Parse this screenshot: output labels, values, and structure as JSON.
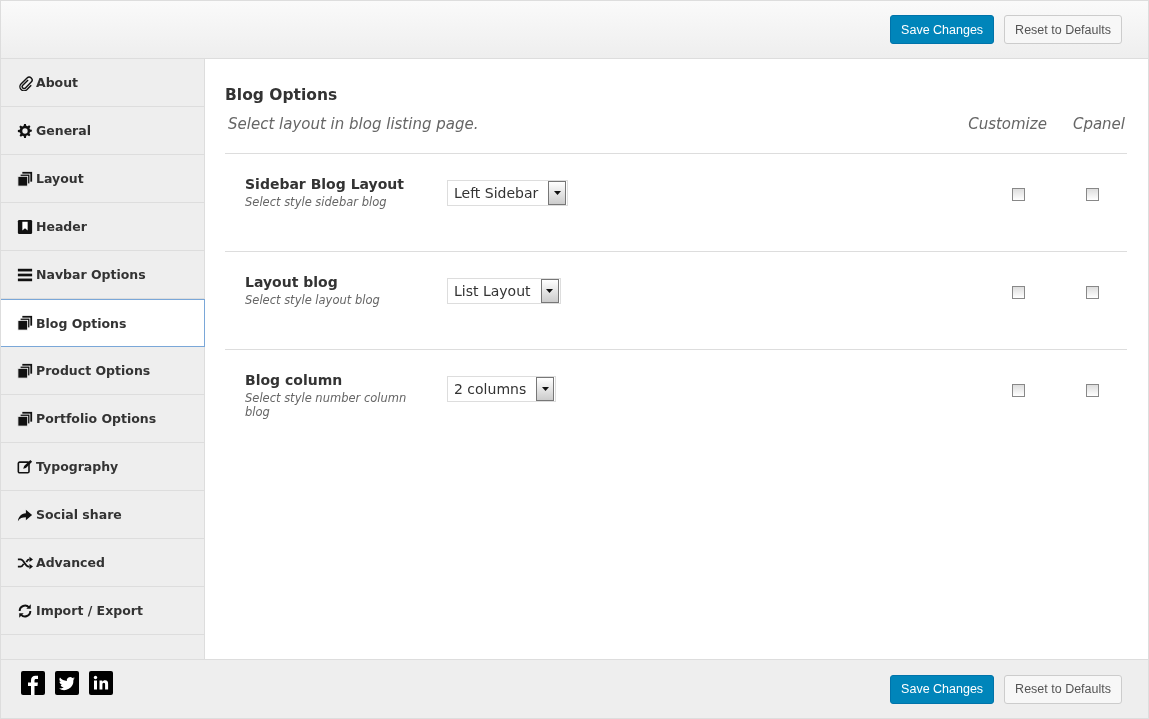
{
  "header": {
    "buttons": [
      {
        "label": "Save Changes",
        "kind": "primary"
      },
      {
        "label": "Reset to Defaults",
        "kind": "secondary"
      }
    ]
  },
  "sidebar": {
    "items": [
      {
        "label": "About",
        "selected": false
      },
      {
        "label": "General",
        "selected": false
      },
      {
        "label": "Layout",
        "selected": false
      },
      {
        "label": "Header",
        "selected": false
      },
      {
        "label": "Navbar Options",
        "selected": false
      },
      {
        "label": "Blog Options",
        "selected": true
      },
      {
        "label": "Product Options",
        "selected": false
      },
      {
        "label": "Portfolio Options",
        "selected": false
      },
      {
        "label": "Typography",
        "selected": false
      },
      {
        "label": "Social share",
        "selected": false
      },
      {
        "label": "Advanced",
        "selected": false
      },
      {
        "label": "Import / Export",
        "selected": false
      }
    ]
  },
  "panel": {
    "title": "Blog Options",
    "description": "Select layout in blog listing page.",
    "columns": [
      "Customize",
      "Cpanel"
    ],
    "rows": [
      {
        "label": "Sidebar Blog Layout",
        "hint": "Select style sidebar blog",
        "value": "Left Sidebar",
        "customize": false,
        "cpanel": false
      },
      {
        "label": "Layout blog",
        "hint": "Select style layout blog",
        "value": "List Layout",
        "customize": false,
        "cpanel": false
      },
      {
        "label": "Blog column",
        "hint": "Select style number column blog",
        "value": "2 columns",
        "customize": false,
        "cpanel": false
      }
    ]
  },
  "footer": {
    "buttons": [
      {
        "label": "Save Changes",
        "kind": "primary"
      },
      {
        "label": "Reset to Defaults",
        "kind": "secondary"
      }
    ]
  }
}
